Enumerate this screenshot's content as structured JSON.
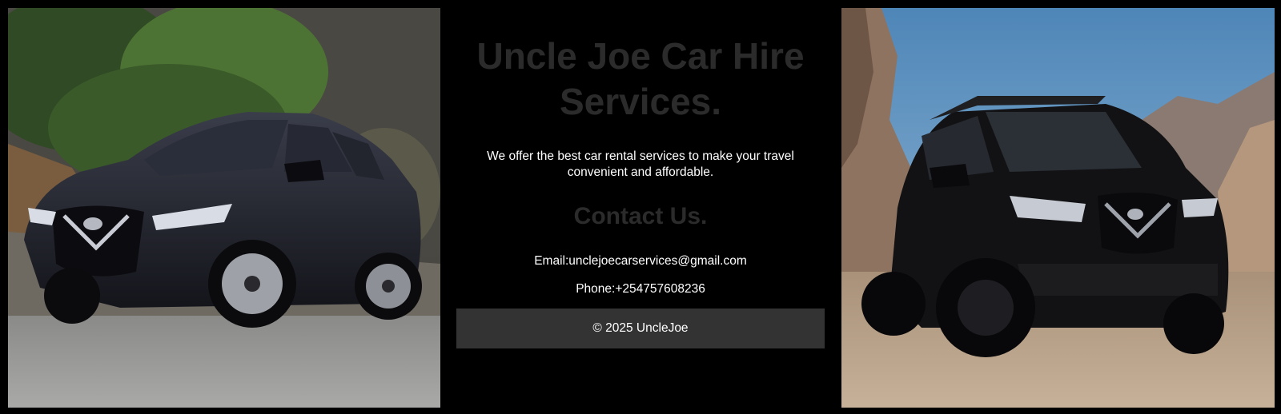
{
  "header": {
    "title": "Uncle Joe Car Hire Services.",
    "tagline": "We offer the best car rental services to make your travel convenient and affordable."
  },
  "contact": {
    "heading": "Contact Us.",
    "email": "Email:unclejoecarservices@gmail.com",
    "phone": "Phone:+254757608236"
  },
  "footer": {
    "copyright": "© 2025 UncleJoe"
  },
  "images": {
    "left": "black-nissan-sedan-photo",
    "right": "black-nissan-suv-photo"
  },
  "colors": {
    "background": "#000000",
    "heading": "#2b2b2b",
    "text": "#ffffff",
    "footer_bg": "#333333"
  }
}
